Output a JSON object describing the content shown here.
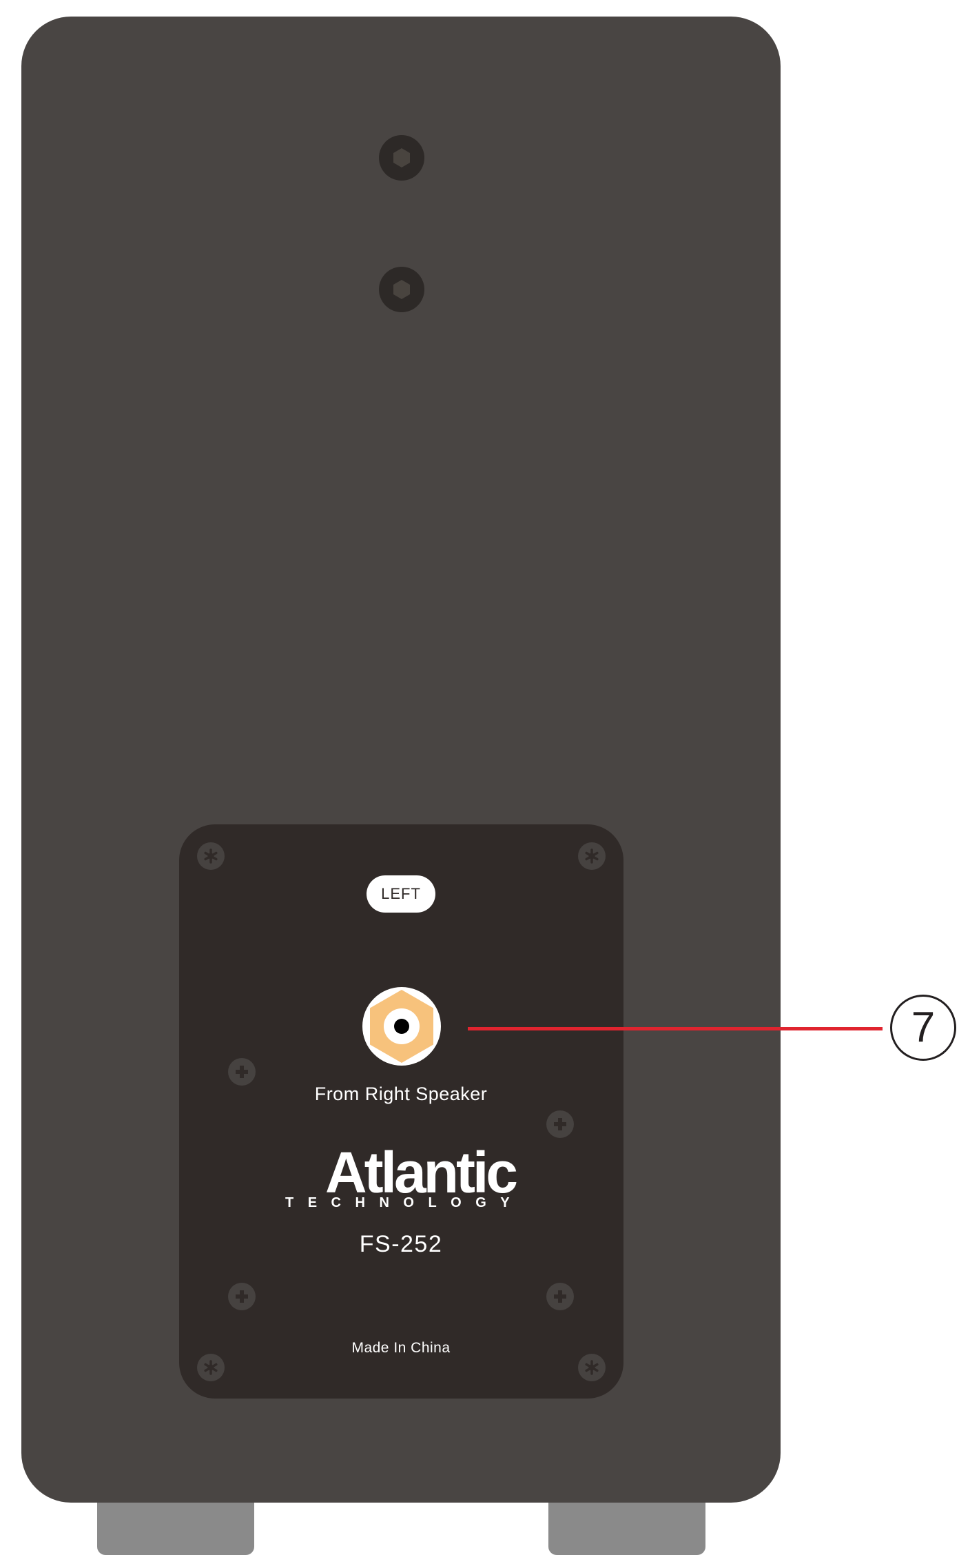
{
  "panel": {
    "channel_label": "LEFT",
    "input_label": "From Right Speaker",
    "model": "FS-252",
    "origin": "Made In China"
  },
  "brand": {
    "name": "Atlantic",
    "subtitle": "TECHNOLOGY"
  },
  "callout": {
    "number": "7"
  },
  "colors": {
    "cabinet": "#494543",
    "panel": "#302a28",
    "feet": "#8a8a8a",
    "connector": "#f7c27c",
    "callout_line": "#e0242f"
  },
  "icons": {
    "mount_hole": "hex-socket-icon",
    "corner_screw": "torx-screw-icon",
    "panel_screw": "phillips-screw-icon",
    "connector": "rca-jack-icon"
  }
}
